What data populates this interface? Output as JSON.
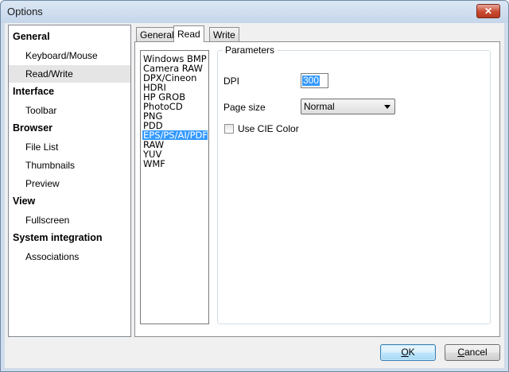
{
  "window": {
    "title": "Options",
    "close_glyph": "✕"
  },
  "sidebar": {
    "categories": [
      {
        "label": "General",
        "items": [
          "Keyboard/Mouse",
          "Read/Write"
        ]
      },
      {
        "label": "Interface",
        "items": [
          "Toolbar"
        ]
      },
      {
        "label": "Browser",
        "items": [
          "File List",
          "Thumbnails",
          "Preview"
        ]
      },
      {
        "label": "View",
        "items": [
          "Fullscreen"
        ]
      },
      {
        "label": "System integration",
        "items": [
          "Associations"
        ]
      }
    ],
    "selected_item": "Read/Write"
  },
  "tabs": {
    "items": [
      "General",
      "Read",
      "Write"
    ],
    "active": "Read"
  },
  "formats": {
    "items": [
      "Windows BMP",
      "Camera RAW",
      "DPX/Cineon",
      "HDRI",
      "HP GROB",
      "PhotoCD",
      "PNG",
      "PDD",
      "EPS/PS/AI/PDF",
      "RAW",
      "YUV",
      "WMF"
    ],
    "selected": "EPS/PS/AI/PDF"
  },
  "parameters": {
    "legend": "Parameters",
    "dpi_label": "DPI",
    "dpi_value": "300",
    "page_size_label": "Page size",
    "page_size_value": "Normal",
    "cie_label": "Use CIE Color",
    "cie_checked": false
  },
  "buttons": {
    "ok_underlined": "O",
    "ok_rest": "K",
    "cancel_underlined": "C",
    "cancel_rest": "ancel"
  },
  "icons": {
    "close": "close-icon",
    "dropdown": "chevron-down-icon"
  }
}
